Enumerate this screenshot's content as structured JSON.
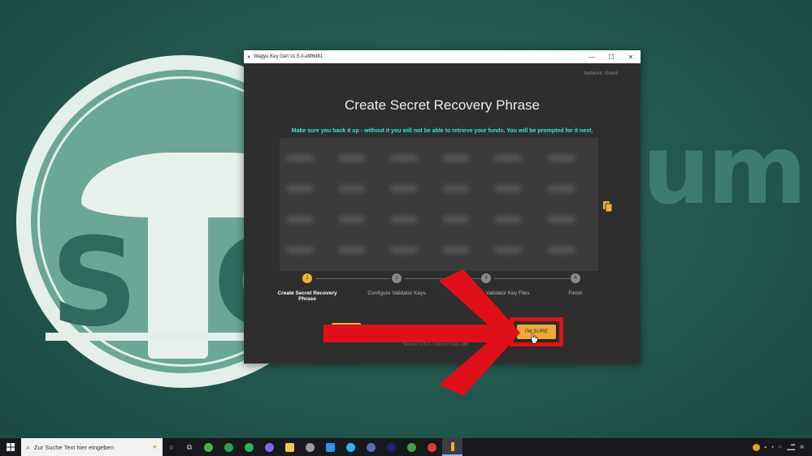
{
  "window": {
    "title": "Wagyu Key Gen v1.5.0-e9f6d81",
    "minimize": "—",
    "maximize": "☐",
    "close": "✕"
  },
  "network": "Network: Goerli",
  "heading": "Create Secret Recovery Phrase",
  "notice": "Make sure you back it up - without it you will not be able to retrieve your funds. You will be prompted for it next.",
  "stepper": {
    "steps": [
      {
        "number": "1",
        "label": "Create Secret Recovery Phrase"
      },
      {
        "number": "2",
        "label": "Configure Validator Keys"
      },
      {
        "number": "3",
        "label": "e Validator Key Files"
      },
      {
        "number": "4",
        "label": "Finish"
      }
    ]
  },
  "buttons": {
    "confirm": "I'M SURE"
  },
  "version_text": "Version: v1.5.0 - Commit Hash: e9f6",
  "background": {
    "word": "um"
  },
  "taskbar": {
    "search_placeholder": "Zur Suche Text hier eingeben"
  },
  "colors": {
    "accent": "#f1b233",
    "notice": "#33ead4",
    "annotation": "#e0101a"
  },
  "icons": {
    "copy": "copy-icon",
    "start": "windows-start-icon",
    "search": "search-icon",
    "task_view": "task-view-icon"
  }
}
